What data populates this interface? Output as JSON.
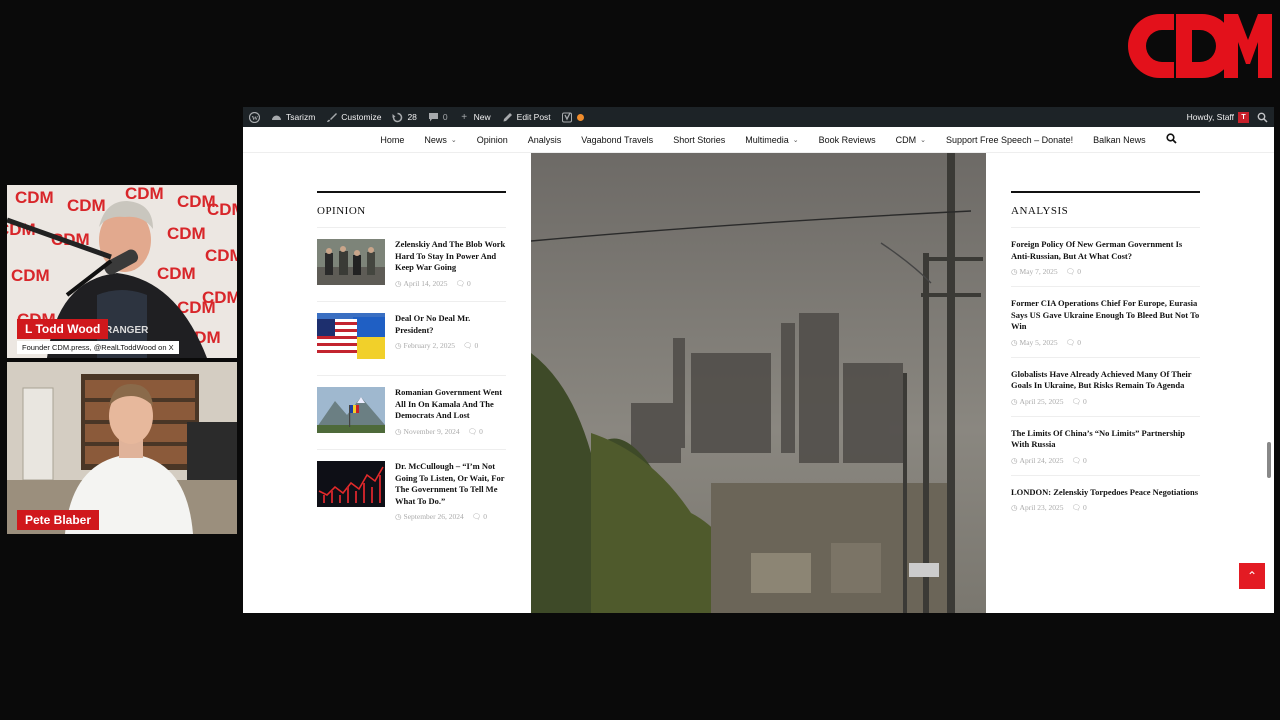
{
  "logo": {
    "text": "CDM",
    "color": "#e3111b"
  },
  "cam_top": {
    "name": "L Todd Wood",
    "subtitle": "Founder CDM.press, @RealLToddWood on X",
    "backdrop_logo": "CDM"
  },
  "cam_bottom": {
    "name": "Pete Blaber"
  },
  "adminbar": {
    "items": [
      {
        "icon": "wordpress-icon",
        "label": ""
      },
      {
        "icon": "dashboard-icon",
        "label": "Tsarizm"
      },
      {
        "icon": "brush-icon",
        "label": "Customize"
      },
      {
        "icon": "updates-icon",
        "label": "28"
      },
      {
        "icon": "comment-icon",
        "label": "0"
      },
      {
        "icon": "plus-icon",
        "label": "New"
      },
      {
        "icon": "pencil-icon",
        "label": "Edit Post"
      },
      {
        "icon": "yoast-icon",
        "label": ""
      }
    ],
    "greeting": "Howdy, Staff"
  },
  "nav": {
    "items": [
      {
        "label": "Home",
        "has_dropdown": false
      },
      {
        "label": "News",
        "has_dropdown": true
      },
      {
        "label": "Opinion",
        "has_dropdown": false
      },
      {
        "label": "Analysis",
        "has_dropdown": false
      },
      {
        "label": "Vagabond Travels",
        "has_dropdown": false
      },
      {
        "label": "Short Stories",
        "has_dropdown": false
      },
      {
        "label": "Multimedia",
        "has_dropdown": true
      },
      {
        "label": "Book Reviews",
        "has_dropdown": false
      },
      {
        "label": "CDM",
        "has_dropdown": true
      },
      {
        "label": "Support Free Speech – Donate!",
        "has_dropdown": false
      },
      {
        "label": "Balkan News",
        "has_dropdown": false
      }
    ]
  },
  "opinion": {
    "title": "OPINION",
    "items": [
      {
        "title": "Zelenskiy And The Blob Work Hard To Stay In Power And Keep War Going",
        "date": "April 14, 2025",
        "comments": "0",
        "thumb": "people-street"
      },
      {
        "title": "Deal Or No Deal Mr. President?",
        "date": "February 2, 2025",
        "comments": "0",
        "thumb": "us-ukraine-flags"
      },
      {
        "title": "Romanian Government Went All In On Kamala And The Democrats And Lost",
        "date": "November 9, 2024",
        "comments": "0",
        "thumb": "mountain-flag"
      },
      {
        "title": "Dr. McCullough – “I’m Not Going To Listen, Or Wait, For The Government To Tell Me What To Do.”",
        "date": "September 26, 2024",
        "comments": "0",
        "thumb": "red-chart"
      }
    ]
  },
  "analysis": {
    "title": "ANALYSIS",
    "items": [
      {
        "title": "Foreign Policy Of New German Government Is Anti-Russian, But At What Cost?",
        "date": "May 7, 2025",
        "comments": "0"
      },
      {
        "title": "Former CIA Operations Chief For Europe, Eurasia Says US Gave Ukraine Enough To Bleed But Not To Win",
        "date": "May 5, 2025",
        "comments": "0"
      },
      {
        "title": "Globalists Have Already Achieved Many Of Their Goals In Ukraine, But Risks Remain To Agenda",
        "date": "April 25, 2025",
        "comments": "0"
      },
      {
        "title": "The Limits Of China’s “No Limits” Partnership With Russia",
        "date": "April 24, 2025",
        "comments": "0"
      },
      {
        "title": "LONDON: Zelenskiy Torpedoes Peace Negotiations",
        "date": "April 23, 2025",
        "comments": "0"
      }
    ]
  },
  "colors": {
    "brand_red": "#e31b23",
    "adminbar": "#1d2327"
  }
}
